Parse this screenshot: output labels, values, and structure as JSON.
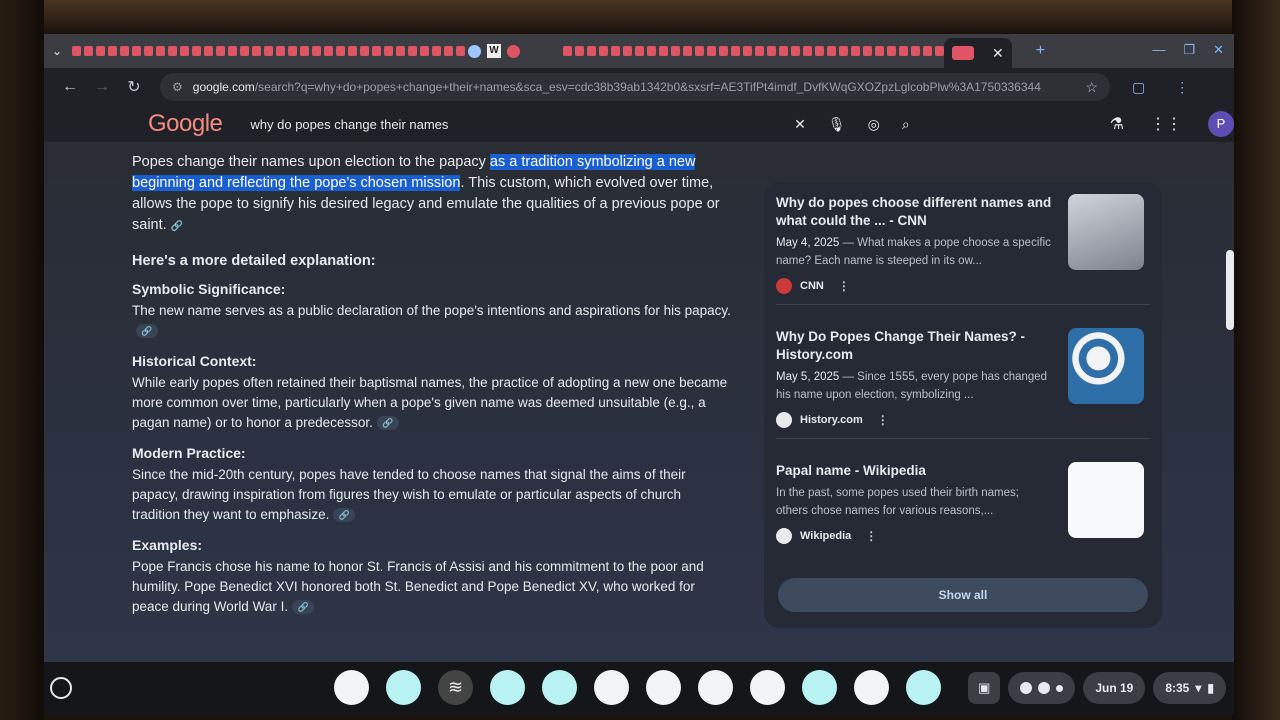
{
  "browser": {
    "url_prefix": "google.com",
    "url_rest": "/search?q=why+do+popes+change+their+names&sca_esv=cdc38b39ab1342b0&sxsrf=AE3TifPt4imdf_DvfKWqGXOZpzLglcobPlw%3A1750336344",
    "tab_close": "✕",
    "new_tab": "+"
  },
  "google": {
    "logo": "Google",
    "query": "why do popes change their names",
    "avatar_letter": "P"
  },
  "answer": {
    "intro_plain": "Popes change their names upon election to the papacy ",
    "intro_highlight": "as a tradition symbolizing a new beginning and reflecting the pope's chosen mission",
    "intro_rest": ". This custom, which evolved over time, allows the pope to signify his desired legacy and emulate the qualities of a previous pope or saint.",
    "more_heading": "Here's a more detailed explanation:",
    "sections": [
      {
        "heading": "Symbolic Significance:",
        "text": "The new name serves as a public declaration of the pope's intentions and aspirations for his papacy."
      },
      {
        "heading": "Historical Context:",
        "text": "While early popes often retained their baptismal names, the practice of adopting a new one became more common over time, particularly when a pope's given name was deemed unsuitable (e.g., a pagan name) or to honor a predecessor."
      },
      {
        "heading": "Modern Practice:",
        "text": "Since the mid-20th century, popes have tended to choose names that signal the aims of their papacy, drawing inspiration from figures they wish to emulate or particular aspects of church tradition they want to emphasize."
      },
      {
        "heading": "Examples:",
        "text": "Pope Francis chose his name to honor St. Francis of Assisi and his commitment to the poor and humility. Pope Benedict XVI honored both St. Benedict and Pope Benedict XV, who worked for peace during World War I."
      }
    ]
  },
  "sources": [
    {
      "title": "Why do popes choose different names and what could the ... - CNN",
      "date": "May 4, 2025",
      "snippet": " — What makes a pope choose a specific name? Each name is steeped in its ow...",
      "source": "CNN"
    },
    {
      "title": "Why Do Popes Change Their Names? - History.com",
      "date": "May 5, 2025",
      "snippet": " — Since 1555, every pope has changed his name upon election, symbolizing ...",
      "source": "History.com"
    },
    {
      "title": "Papal name - Wikipedia",
      "date": "",
      "snippet": "In the past, some popes used their birth names; others chose names for various reasons,...",
      "source": "Wikipedia"
    }
  ],
  "show_all": "Show all",
  "shelf": {
    "date": "Jun 19",
    "time": "8:35"
  },
  "colors": {
    "highlight": "#1a5fd1",
    "background": "#2a2d33",
    "text": "#e8eaed"
  }
}
